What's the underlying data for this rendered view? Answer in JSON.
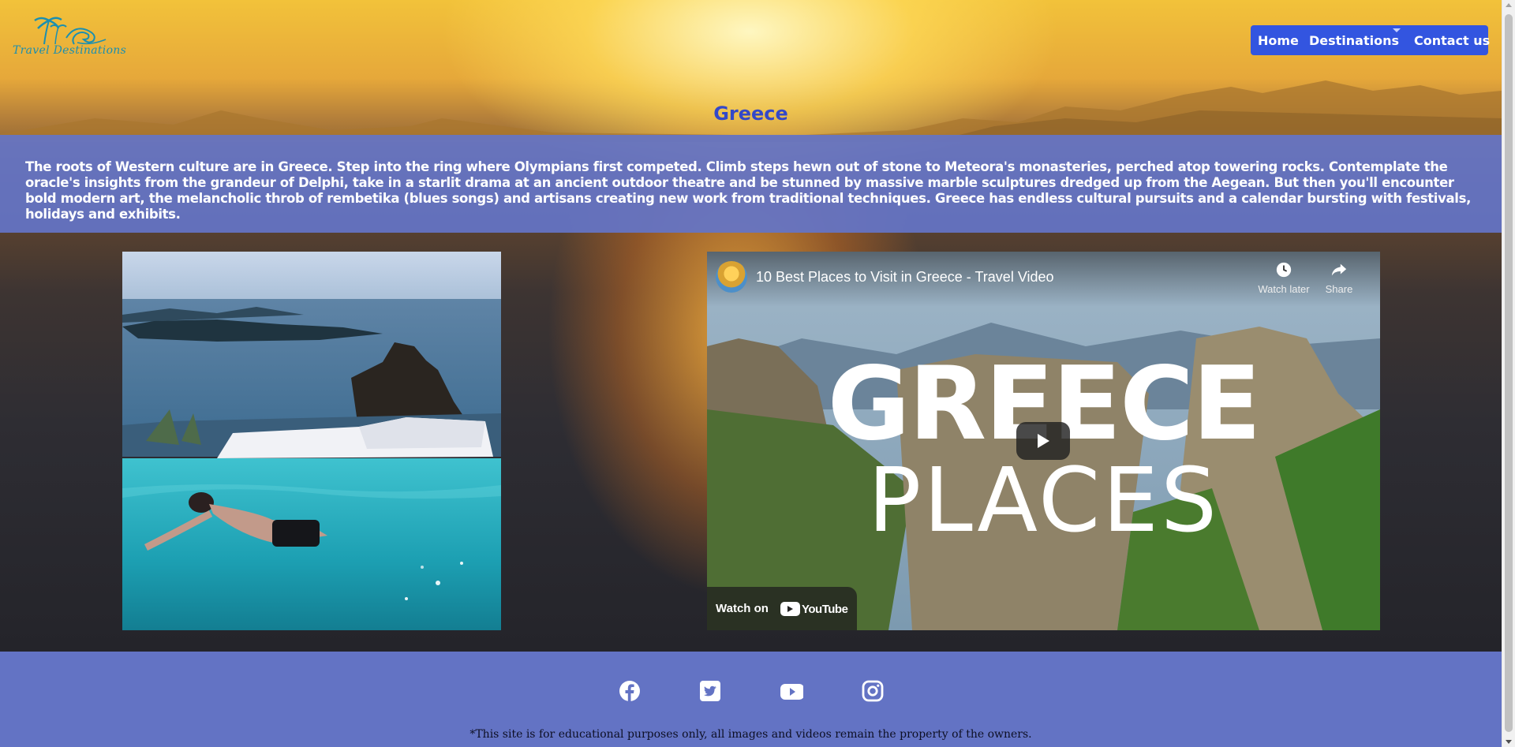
{
  "site": {
    "logo_text": "Travel Destinations"
  },
  "nav": {
    "items": [
      {
        "label": "Home"
      },
      {
        "label": "Destinations"
      },
      {
        "label": "Contact us"
      }
    ]
  },
  "page": {
    "title": "Greece",
    "intro": "The roots of Western culture are in Greece. Step into the ring where Olympians first competed. Climb steps hewn out of stone to Meteora's monasteries, perched atop towering rocks. Contemplate the oracle's insights from the grandeur of Delphi, take in a starlit drama at an ancient outdoor theatre and be stunned by massive marble sculptures dredged up from the Aegean. But then you'll encounter bold modern art, the melancholic throb of rembetika (blues songs) and artisans creating new work from traditional techniques. Greece has endless cultural pursuits and a calendar bursting with festivals, holidays and exhibits."
  },
  "video": {
    "title": "10 Best Places to Visit in Greece - Travel Video",
    "watch_later_label": "Watch later",
    "share_label": "Share",
    "thumb_line1": "GREECE",
    "thumb_line2": "PLACES",
    "watch_on_label": "Watch on",
    "yt_brand": "YouTube"
  },
  "footer": {
    "social_icons": [
      "facebook-icon",
      "twitter-icon",
      "youtube-icon",
      "instagram-icon"
    ],
    "disclaimer": "*This site is for educational purposes only, all images and videos remain the property of the owners."
  },
  "colors": {
    "nav_bg": "#3355e0",
    "title": "#3348c9",
    "band": "#6474c6",
    "footer": "#6373c4"
  }
}
